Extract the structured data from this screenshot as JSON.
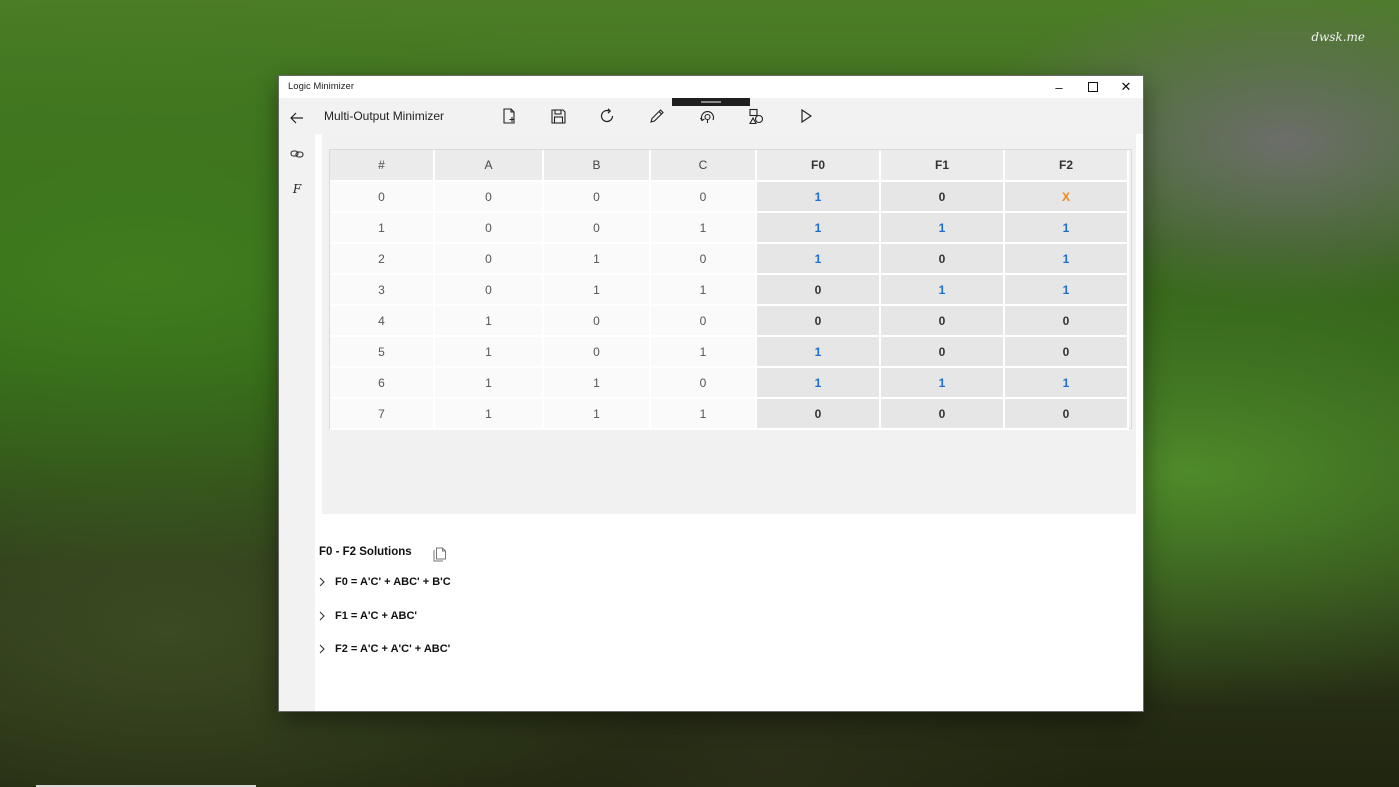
{
  "wallpaper": {
    "watermark": "dwsk.me"
  },
  "window": {
    "title": "Logic Minimizer",
    "controls": {
      "minimize": "–",
      "close": "✕"
    }
  },
  "nav": {
    "back_icon": "back-arrow-icon",
    "link_icon": "link-icon",
    "function_icon": "function-icon",
    "function_label": "F"
  },
  "toolbar": {
    "mode_title": "Multi-Output Minimizer",
    "buttons": [
      {
        "name": "new-file",
        "icon": "new-file-icon"
      },
      {
        "name": "save",
        "icon": "save-icon"
      },
      {
        "name": "refresh",
        "icon": "refresh-icon"
      },
      {
        "name": "edit",
        "icon": "pencil-icon"
      },
      {
        "name": "random",
        "icon": "random-icon"
      },
      {
        "name": "convert",
        "icon": "shapes-icon"
      },
      {
        "name": "run",
        "icon": "play-icon"
      }
    ]
  },
  "truth_table": {
    "headers": [
      "#",
      "A",
      "B",
      "C",
      "F0",
      "F1",
      "F2"
    ],
    "rows": [
      [
        "0",
        "0",
        "0",
        "0",
        "1",
        "0",
        "X"
      ],
      [
        "1",
        "0",
        "0",
        "1",
        "1",
        "1",
        "1"
      ],
      [
        "2",
        "0",
        "1",
        "0",
        "1",
        "0",
        "1"
      ],
      [
        "3",
        "0",
        "1",
        "1",
        "0",
        "1",
        "1"
      ],
      [
        "4",
        "1",
        "0",
        "0",
        "0",
        "0",
        "0"
      ],
      [
        "5",
        "1",
        "0",
        "1",
        "1",
        "0",
        "0"
      ],
      [
        "6",
        "1",
        "1",
        "0",
        "1",
        "1",
        "1"
      ],
      [
        "7",
        "1",
        "1",
        "1",
        "0",
        "0",
        "0"
      ]
    ]
  },
  "solutions": {
    "header": "F0 - F2 Solutions",
    "items": [
      "F0 = A'C' + ABC' + B'C",
      "F1 = A'C + ABC'",
      "F2 = A'C + A'C' + ABC'"
    ]
  },
  "colors": {
    "one": "#1f6fd1",
    "dont_care": "#f08a17"
  }
}
